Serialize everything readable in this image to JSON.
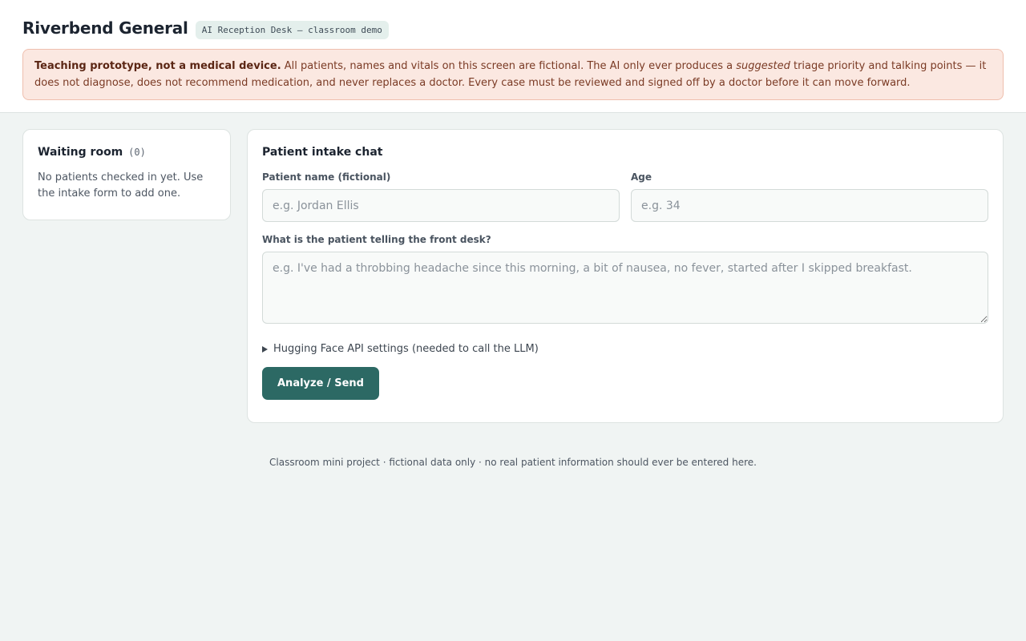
{
  "header": {
    "title": "Riverbend General",
    "badge": "AI Reception Desk — classroom demo",
    "warning": {
      "strong": "Teaching prototype, not a medical device.",
      "text_before": " All patients, names and vitals on this screen are fictional. The AI only ever produces a ",
      "emphasis": "suggested",
      "text_after": " triage priority and talking points — it does not diagnose, does not recommend medication, and never replaces a doctor. Every case must be reviewed and signed off by a doctor before it can move forward."
    }
  },
  "waiting_room": {
    "title": "Waiting room",
    "count": "(0)",
    "empty_message": "No patients checked in yet. Use the intake form to add one."
  },
  "intake": {
    "title": "Patient intake chat",
    "name_label": "Patient name (fictional)",
    "name_placeholder": "e.g. Jordan Ellis",
    "name_value": "",
    "age_label": "Age",
    "age_placeholder": "e.g. 34",
    "age_value": "",
    "complaint_label": "What is the patient telling the front desk?",
    "complaint_placeholder": "e.g. I've had a throbbing headache since this morning, a bit of nausea, no fever, started after I skipped breakfast.",
    "complaint_value": "",
    "settings_label": "Hugging Face API settings (needed to call the LLM)",
    "submit_label": "Analyze / Send"
  },
  "footer": {
    "text": "Classroom mini project · fictional data only · no real patient information should ever be entered here."
  },
  "colors": {
    "accent": "#2c6964",
    "warning_bg": "#fbe8e1",
    "warning_border": "#efbfae",
    "page_bg": "#f0f4f3"
  },
  "icons": {
    "settings_toggle": "triangle-right-icon"
  }
}
